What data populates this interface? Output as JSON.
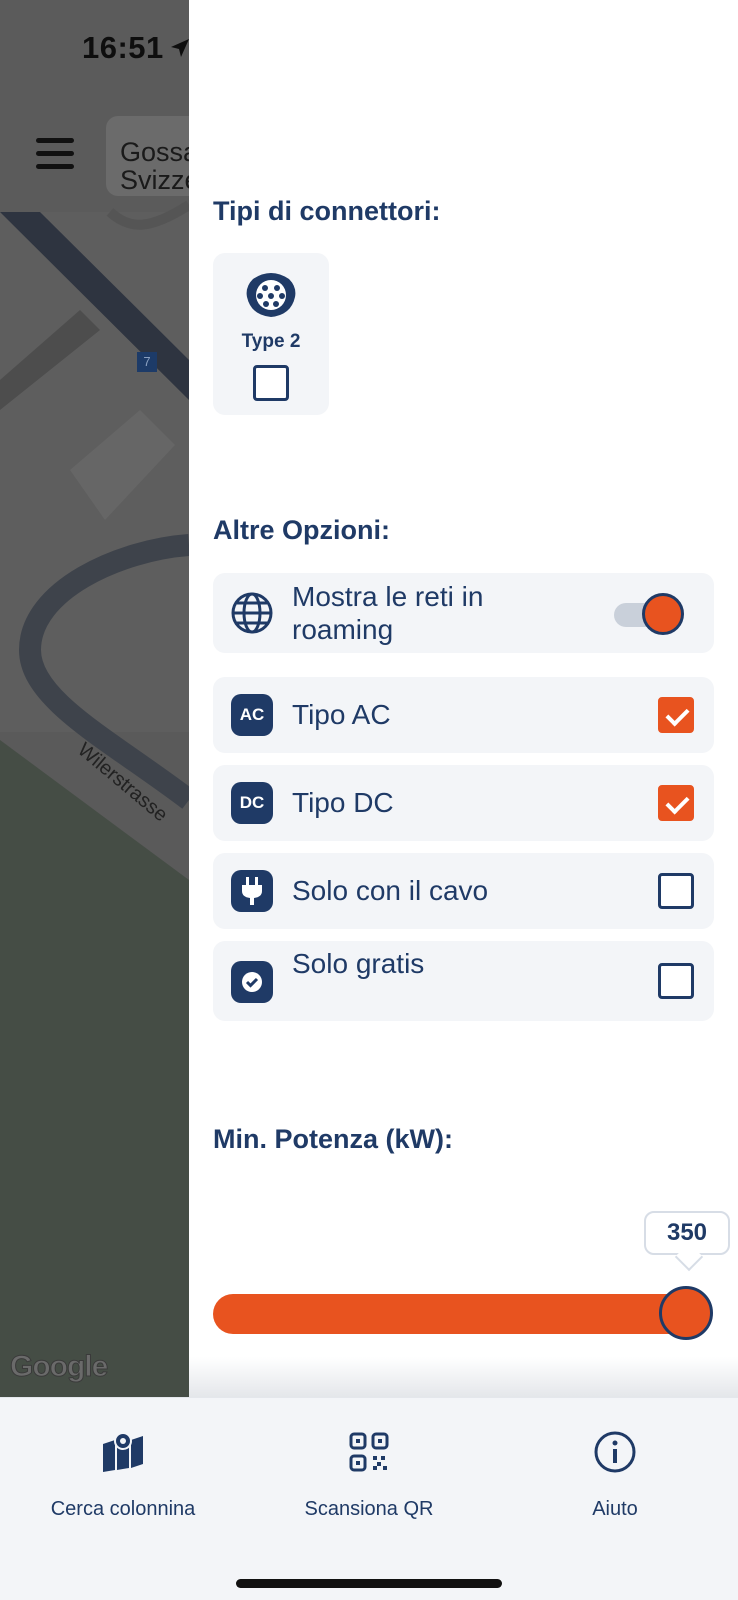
{
  "status_bar": {
    "time": "16:51"
  },
  "map": {
    "search_text": "Gossau Svizzera",
    "street_label": "Wilerstrasse",
    "badge": "7",
    "attribution": "Google"
  },
  "filters": {
    "connectors_title": "Tipi di connettori:",
    "connectors": [
      {
        "label": "Type 2",
        "icon": "type2-connector-icon",
        "checked": false
      }
    ],
    "options_title": "Altre Opzioni:",
    "roaming": {
      "label": "Mostra le reti in roaming",
      "icon": "globe-icon",
      "enabled": true
    },
    "options": [
      {
        "label": "Tipo AC",
        "icon_text": "AC",
        "checked": true
      },
      {
        "label": "Tipo DC",
        "icon_text": "DC",
        "checked": true
      },
      {
        "label": "Solo con il cavo",
        "icon": "plug-icon",
        "checked": false
      },
      {
        "label": "Solo gratis",
        "icon": "free-badge-icon",
        "checked": false
      }
    ],
    "power_title": "Min. Potenza (kW):",
    "power_value": "350",
    "power_fraction": 1.0
  },
  "colors": {
    "primary": "#1f3a66",
    "accent": "#e8531f",
    "card": "#f3f5f8"
  },
  "bottom_nav": [
    {
      "label": "Cerca colonnina",
      "icon": "map-icon"
    },
    {
      "label": "Scansiona QR",
      "icon": "qr-code-icon"
    },
    {
      "label": "Aiuto",
      "icon": "info-icon"
    }
  ]
}
